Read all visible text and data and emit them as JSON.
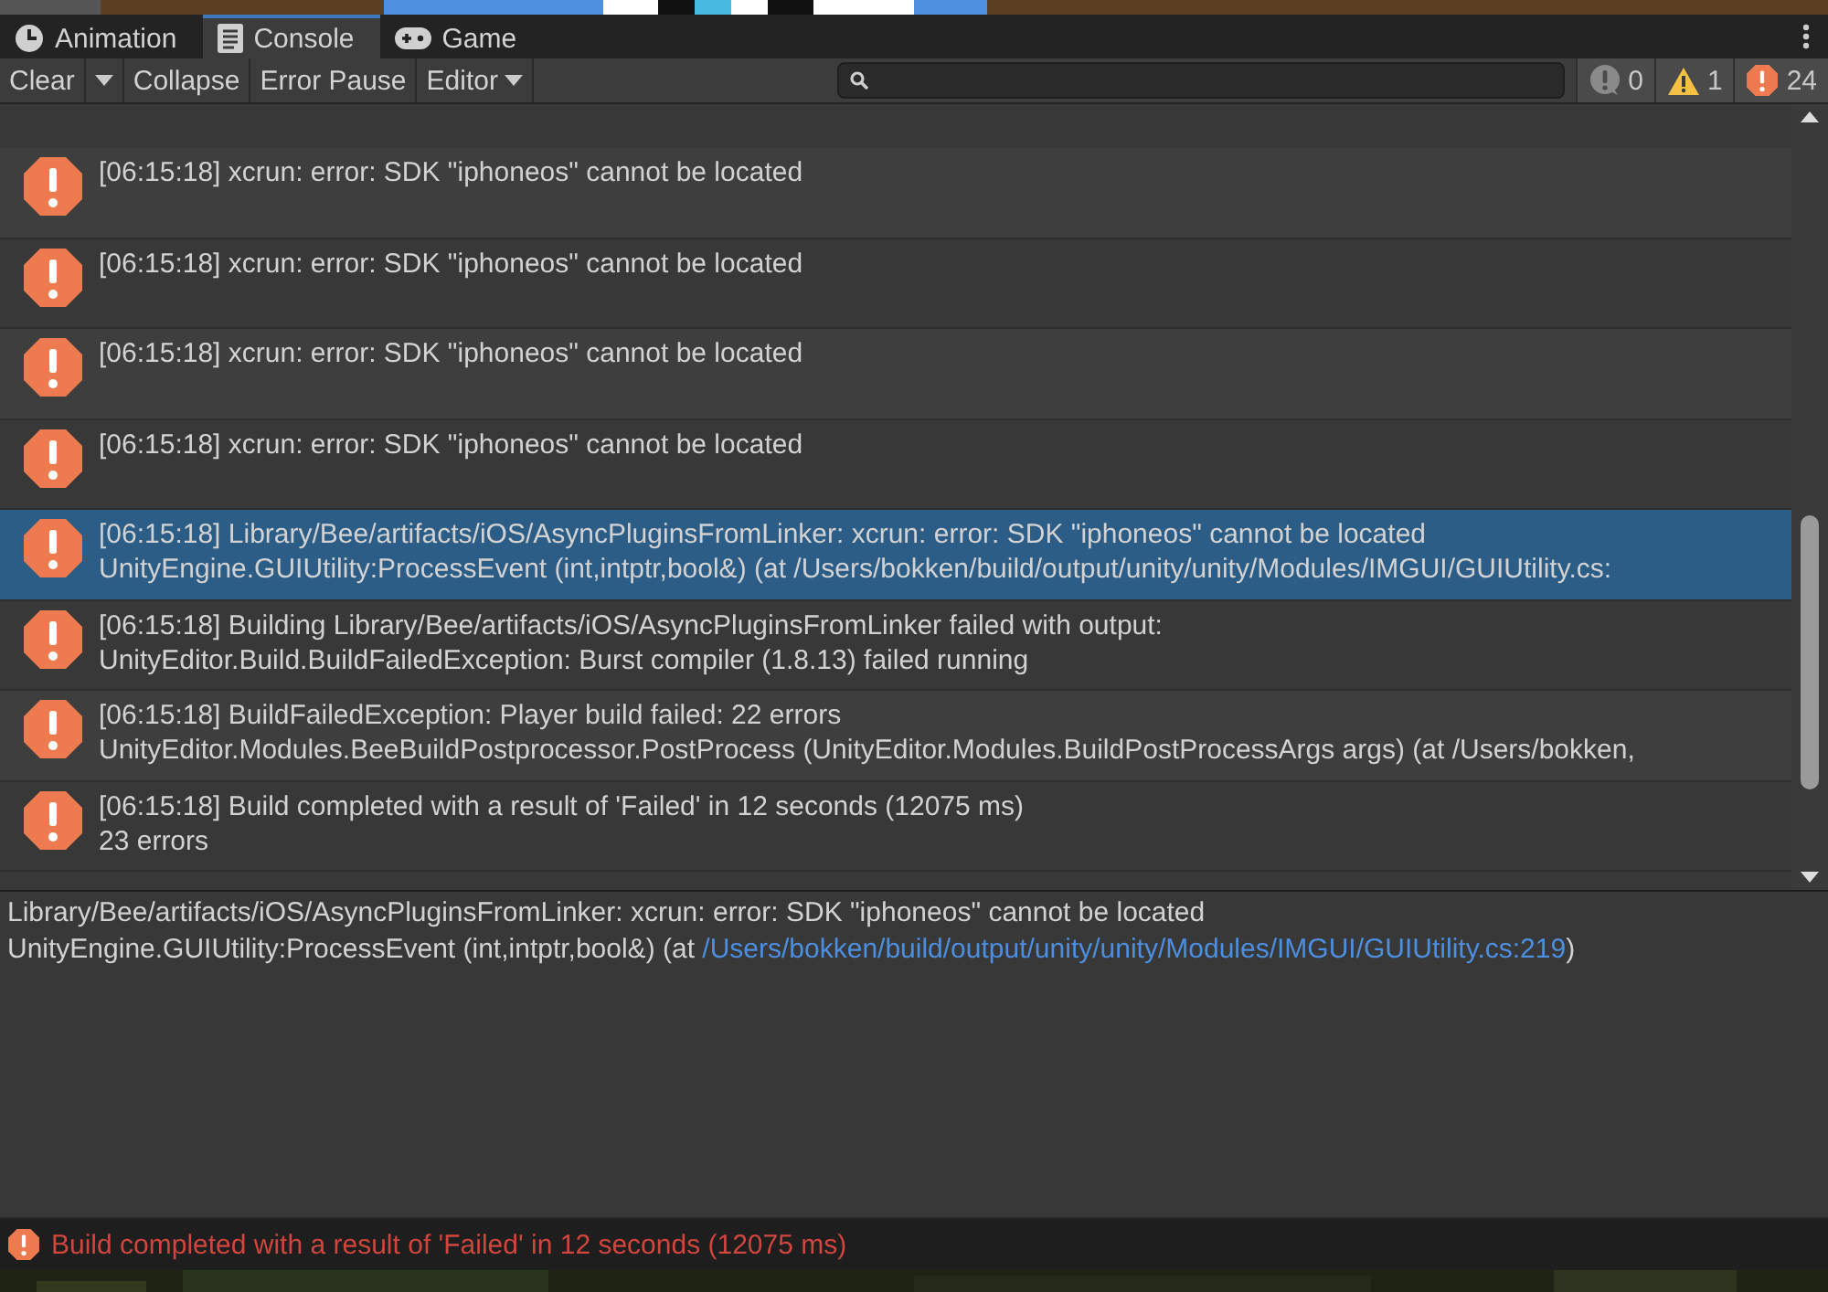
{
  "tabs": [
    {
      "label": "Animation",
      "kind": "clock",
      "selected": false
    },
    {
      "label": "Console",
      "kind": "console",
      "selected": true
    },
    {
      "label": "Game",
      "kind": "gamepad",
      "selected": false
    }
  ],
  "toolbar": {
    "clear": "Clear",
    "collapse": "Collapse",
    "error_pause": "Error Pause",
    "editor": "Editor",
    "counters": [
      {
        "kind": "info",
        "count": "0"
      },
      {
        "kind": "warning",
        "count": "1"
      },
      {
        "kind": "error",
        "count": "24"
      }
    ]
  },
  "log": [
    {
      "lines": [
        "[06:15:18] xcrun: error: SDK \"iphoneos\" cannot be located"
      ],
      "selected": false
    },
    {
      "lines": [
        "[06:15:18] xcrun: error: SDK \"iphoneos\" cannot be located"
      ],
      "selected": false
    },
    {
      "lines": [
        "[06:15:18] xcrun: error: SDK \"iphoneos\" cannot be located"
      ],
      "selected": false
    },
    {
      "lines": [
        "[06:15:18] xcrun: error: SDK \"iphoneos\" cannot be located"
      ],
      "selected": false
    },
    {
      "lines": [
        "[06:15:18] Library/Bee/artifacts/iOS/AsyncPluginsFromLinker: xcrun: error: SDK \"iphoneos\" cannot be located",
        "UnityEngine.GUIUtility:ProcessEvent (int,intptr,bool&) (at /Users/bokken/build/output/unity/unity/Modules/IMGUI/GUIUtility.cs:"
      ],
      "selected": true
    },
    {
      "lines": [
        "[06:15:18] Building Library/Bee/artifacts/iOS/AsyncPluginsFromLinker failed with output:",
        "UnityEditor.Build.BuildFailedException: Burst compiler (1.8.13) failed running"
      ],
      "selected": false
    },
    {
      "lines": [
        "[06:15:18] BuildFailedException: Player build failed: 22 errors",
        "UnityEditor.Modules.BeeBuildPostprocessor.PostProcess (UnityEditor.Modules.BuildPostProcessArgs args) (at /Users/bokken,"
      ],
      "selected": false
    },
    {
      "lines": [
        "[06:15:18] Build completed with a result of 'Failed' in 12 seconds (12075 ms)",
        "23 errors"
      ],
      "selected": false
    }
  ],
  "detail": {
    "line_1": "Library/Bee/artifacts/iOS/AsyncPluginsFromLinker: xcrun: error: SDK \"iphoneos\" cannot be located",
    "line_2": "UnityEngine.GUIUtility:ProcessEvent (int,intptr,bool&) (at",
    "link": "/Users/bokken/build/output/unity/unity/Modules/IMGUI/GUIUtility.cs:219",
    "line_2_end": ")"
  },
  "status_bar": {
    "message": "Build completed with a result of 'Failed' in 12 seconds (12075 ms)"
  }
}
